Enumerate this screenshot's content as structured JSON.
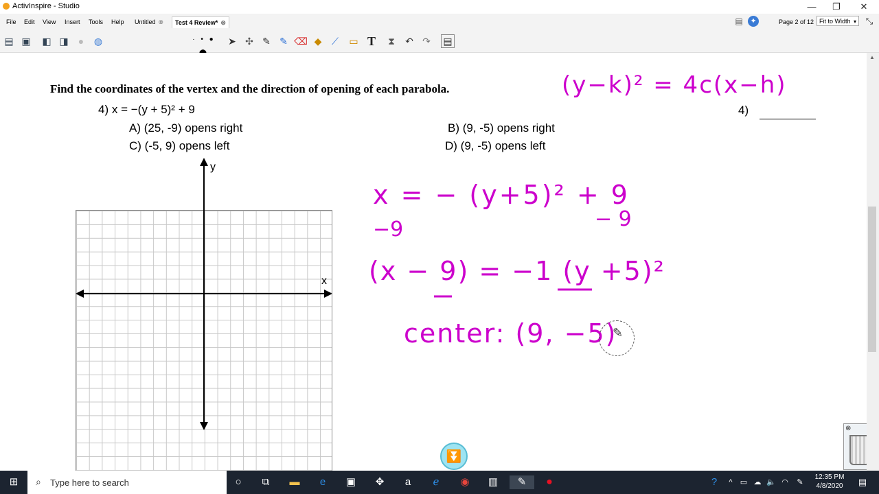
{
  "window": {
    "title": "ActivInspire - Studio"
  },
  "menu": [
    "File",
    "Edit",
    "View",
    "Insert",
    "Tools",
    "Help"
  ],
  "tabs": [
    {
      "label": "Untitled"
    },
    {
      "label": "Test 4 Review*"
    }
  ],
  "page_info": "Page 2 of 12",
  "zoom": "Fit to Width",
  "palette_colors": [
    "#e8000e",
    "#ffa500",
    "#ffff00",
    "#00c000",
    "#804000",
    "#ff99cc",
    "#9b0000",
    "#00a0ff",
    "#0000ff",
    "#ff00ff",
    "#0a0a0a",
    "#808080",
    "#c0c0c0",
    "#ffffff"
  ],
  "question": {
    "instruction": "Find the coordinates of the vertex and the direction of opening of each parabola.",
    "number": "4)",
    "equation": "x = −(y + 5)² + 9",
    "choices": {
      "A": "A) (25, -9) opens right",
      "B": "B) (9, -5) opens right",
      "C": "C) (-5, 9) opens left",
      "D": "D) (9, -5) opens left"
    },
    "answer_label": "4)",
    "y_axis_label": "y",
    "x_axis_label": "x"
  },
  "ink_notes": {
    "formula": "(y−k)² = 4c(x−h)",
    "line1": "x = − (y+5)² + 9",
    "line2_left": "−9",
    "line2_right": "− 9",
    "line3": "(x − 9) = −1 (y +5)²",
    "line4": "center: (9, −5)",
    "ink_color": "#cc00cc"
  },
  "taskbar": {
    "search_placeholder": "Type here to search",
    "time": "12:35 PM",
    "date": "4/8/2020"
  }
}
